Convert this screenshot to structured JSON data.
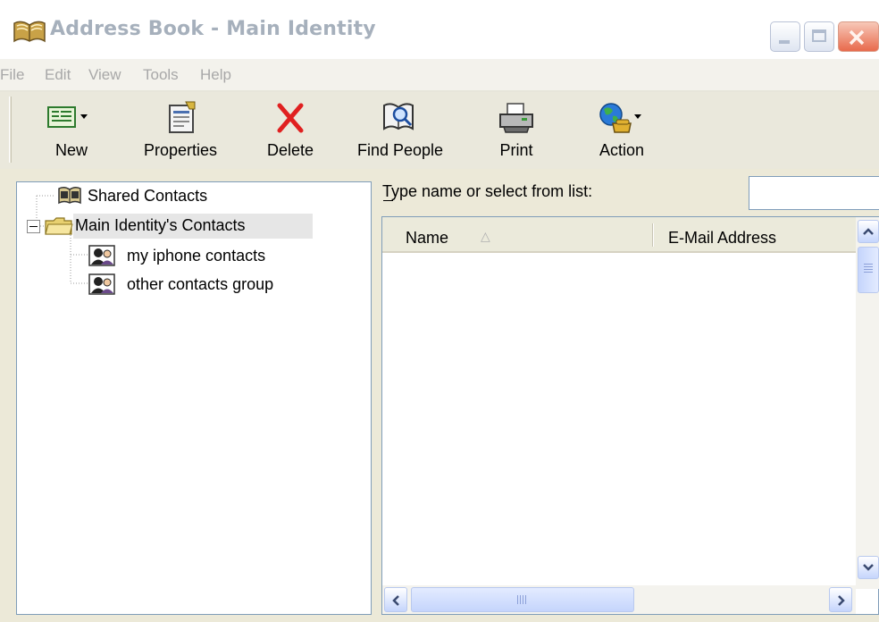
{
  "window": {
    "title": "Address Book - Main Identity",
    "icon": "address-book-icon"
  },
  "menu": {
    "items": [
      "File",
      "Edit",
      "View",
      "Tools",
      "Help"
    ]
  },
  "toolbar": {
    "buttons": [
      {
        "label": "New",
        "icon": "new-contact-icon"
      },
      {
        "label": "Properties",
        "icon": "properties-icon"
      },
      {
        "label": "Delete",
        "icon": "delete-x-icon"
      },
      {
        "label": "Find People",
        "icon": "find-people-icon"
      },
      {
        "label": "Print",
        "icon": "printer-icon"
      },
      {
        "label": "Action",
        "icon": "globe-phone-icon"
      }
    ]
  },
  "tree": {
    "items": [
      {
        "label": "Shared Contacts",
        "icon": "shared-book-icon",
        "level": 0
      },
      {
        "label": "Main Identity's Contacts",
        "icon": "folder-icon",
        "level": 0,
        "expanded": true,
        "selected": true
      },
      {
        "label": "my iphone contacts",
        "icon": "group-icon",
        "level": 1
      },
      {
        "label": "other contacts group",
        "icon": "group-icon",
        "level": 1
      }
    ]
  },
  "search": {
    "label": "Type name or select from list:",
    "value": ""
  },
  "list": {
    "columns": [
      "Name",
      "E-Mail Address"
    ],
    "sort_indicator": "△",
    "rows": []
  },
  "colors": {
    "title_text": "#a6b0bc",
    "chrome": "#ece9d8",
    "border": "#7f9db9",
    "close_button": "#e85b3e"
  }
}
